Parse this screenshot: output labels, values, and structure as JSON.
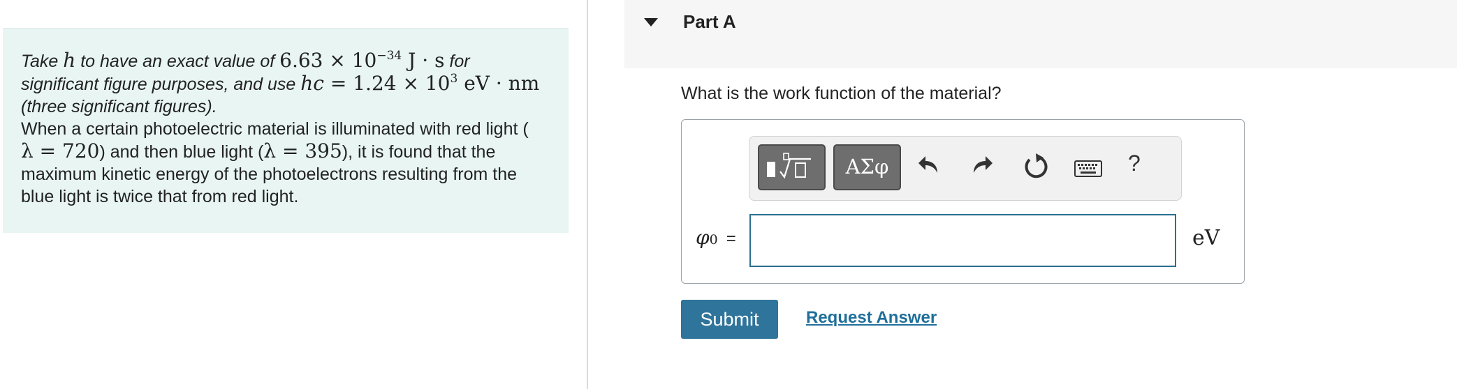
{
  "intro": {
    "line1_prefix": "Take ",
    "line1_h": "h",
    "line1_mid": " to have an exact value of ",
    "line1_value": "6.63 × 10",
    "line1_exp": "−34",
    "line1_unit": " J · s",
    "line1_suffix": " for",
    "line2_prefix": "significant figure purposes, and use ",
    "line2_hc": "hc",
    "line2_value": " = 1.24 × 10",
    "line2_exp": "3",
    "line2_unit": " eV · nm",
    "line3": "(three significant figures).",
    "line4": "When a certain photoelectric material is illuminated with red light (",
    "line5_red": "λ = 720",
    "line5_mid": ") and then blue light (",
    "line5_blue": "λ = 395",
    "line5_suffix": "), it is found that the",
    "line6": "maximum kinetic energy of the photoelectrons resulting from the",
    "line7": "blue light is twice that from red light."
  },
  "part": {
    "title": "Part A",
    "question": "What is the work function of the material?"
  },
  "toolbar": {
    "symbols_label": "ΑΣφ",
    "help_label": "?",
    "icons": [
      "templates-icon",
      "undo-icon",
      "redo-icon",
      "reset-icon",
      "keyboard-icon",
      "help-icon"
    ]
  },
  "answer": {
    "variable": "φ",
    "subscript": "0",
    "equals": "=",
    "value": "",
    "unit": "eV"
  },
  "actions": {
    "submit_label": "Submit",
    "request_label": "Request Answer"
  },
  "colors": {
    "intro_bg": "#e8f5f3",
    "submit_bg": "#2f749a",
    "link": "#1f6f9a",
    "input_border": "#2a6f8e"
  }
}
